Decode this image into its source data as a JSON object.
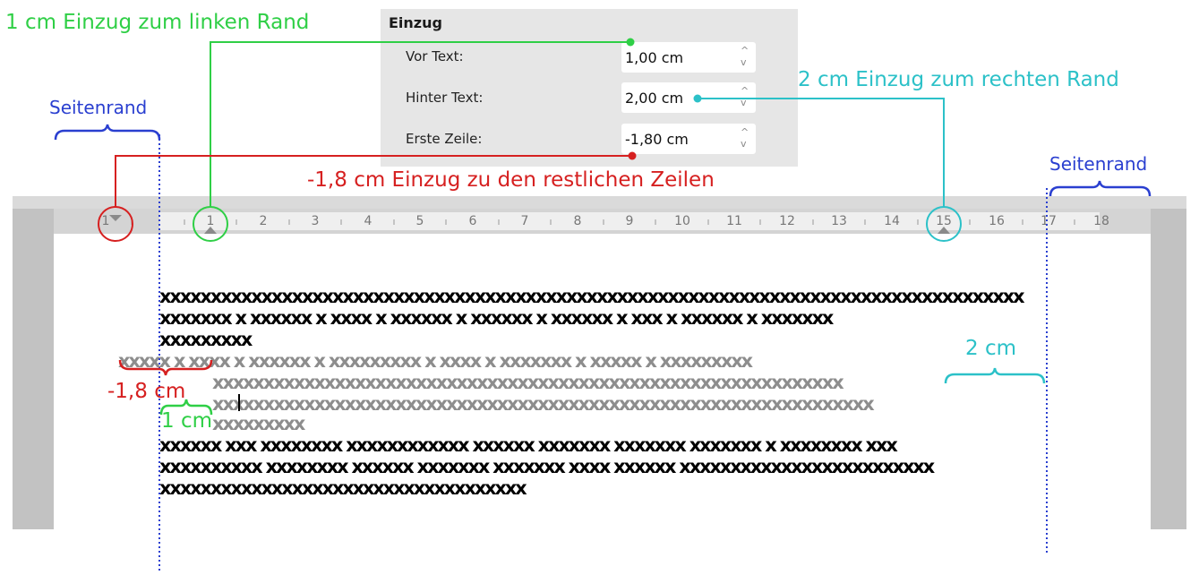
{
  "dialog": {
    "title": "Einzug",
    "fields": [
      {
        "label": "Vor Text:",
        "value": "1,00 cm"
      },
      {
        "label": "Hinter Text:",
        "value": "2,00 cm"
      },
      {
        "label": "Erste Zeile:",
        "value": "-1,80 cm"
      }
    ]
  },
  "annotations": {
    "left_indent": "1 cm Einzug zum linken Rand",
    "right_indent": "2 cm Einzug zum rechten Rand",
    "first_line": "-1,8 cm Einzug zu den restlichen Zeilen",
    "margin_left": "Seitenrand",
    "margin_right": "Seitenrand",
    "measure_right": "2 cm",
    "measure_first": "-1,8 cm",
    "measure_left": "1 cm"
  },
  "ruler": {
    "labels": [
      "1",
      "1",
      "2",
      "3",
      "4",
      "5",
      "6",
      "7",
      "8",
      "9",
      "10",
      "11",
      "12",
      "13",
      "14",
      "15",
      "16",
      "17",
      "18"
    ]
  },
  "document": {
    "para1": [
      "xxxxxxxxxxxxxxxxxxxxxxxxxxxxxxxxxxxxxxxxxxxxxxxxxxxxxxxxxxxxxxxxxxxxxxxxxxxxxxxxxxxxx",
      "xxxxxxx x xxxxxx x xxxx x xxxxxx x xxxxxx x xxxxxx x xxx x xxxxxx x xxxxxxx",
      "xxxxxxxxx"
    ],
    "para2": [
      "xxxxx x xxxx x xxxxxx x xxxxxxxxx x xxxx x xxxxxxx x xxxxx x xxxxxxxxx",
      "xxxxxxxxxxxxxxxxxxxxxxxxxxxxxxxxxxxxxxxxxxxxxxxxxxxxxxxxxxxxxx",
      "xxxxxxxxxxxxxxxxxxxxxxxxxxxxxxxxxxxxxxxxxxxxxxxxxxxxxxxxxxxxxxxxx",
      "xxxxxxxxx"
    ],
    "para3": [
      "xxxxxx xxx xxxxxxxx xxxxxxxxxxxx xxxxxx xxxxxxx xxxxxxx xxxxxxx x xxxxxxxx xxx",
      "xxxxxxxxxx xxxxxxxx xxxxxx xxxxxxx xxxxxxx xxxx xxxxxx xxxxxxxxxxxxxxxxxxxxxxxxx",
      "xxxxxxxxxxxxxxxxxxxxxxxxxxxxxxxxxxxx"
    ]
  },
  "colors": {
    "green": "#2fcf46",
    "cyan": "#2cc1c8",
    "red": "#d62020",
    "blue": "#2a3fd0"
  }
}
